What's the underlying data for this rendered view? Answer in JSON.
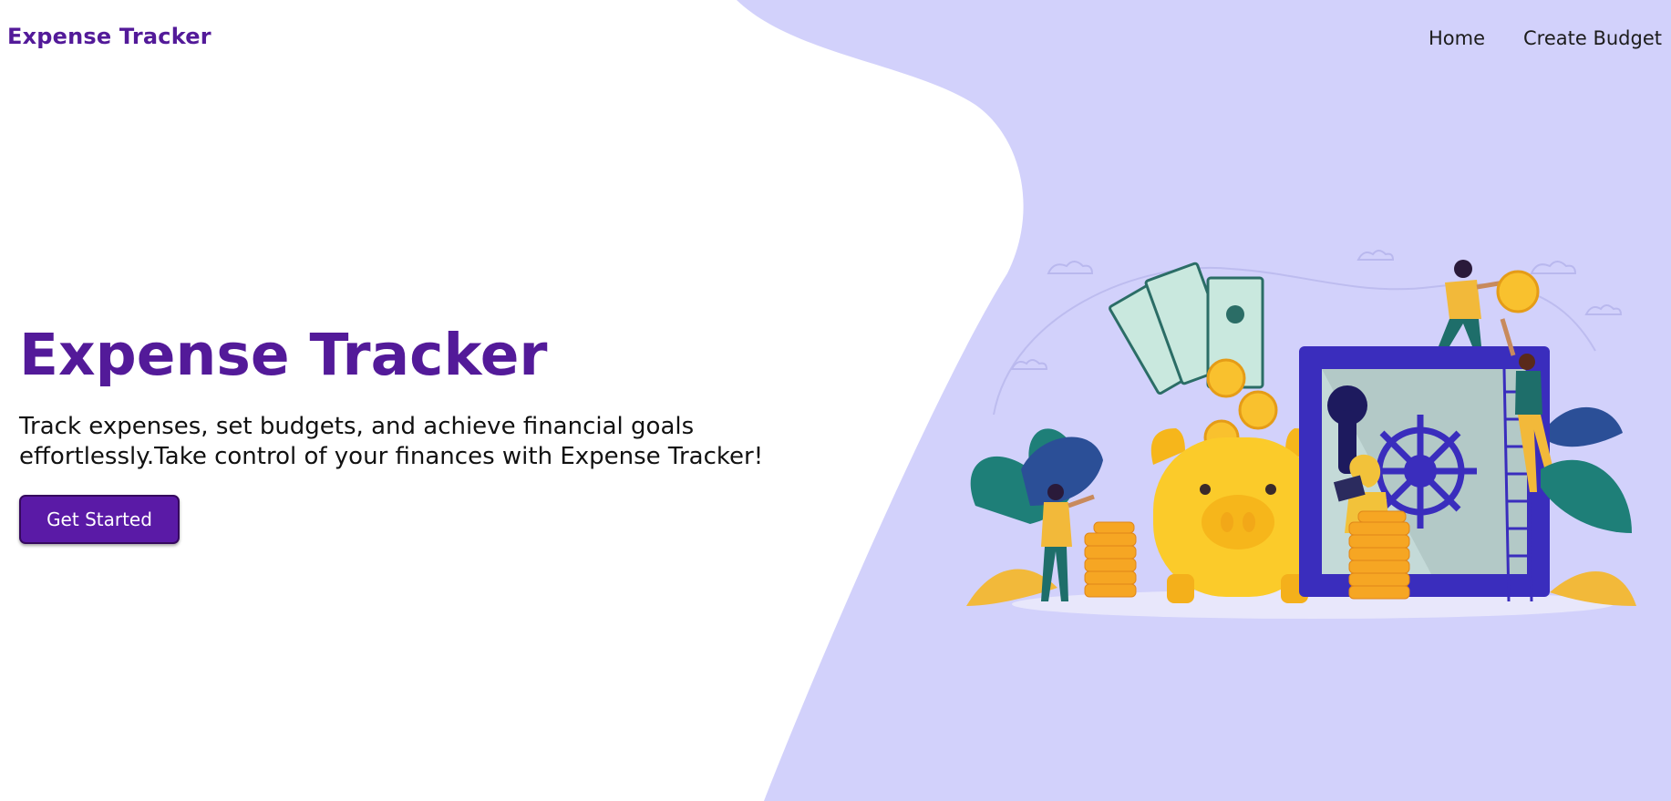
{
  "navbar": {
    "brand": "Expense Tracker",
    "links": [
      "Home",
      "Create Budget"
    ]
  },
  "hero": {
    "title": "Expense Tracker",
    "description": "Track expenses, set budgets, and achieve financial goals effortlessly.Take control of your finances with Expense Tracker!",
    "cta_label": "Get Started"
  },
  "colors": {
    "brand": "#531a99",
    "button": "#5a1aa6",
    "background_shape": "#d2d1fb"
  }
}
